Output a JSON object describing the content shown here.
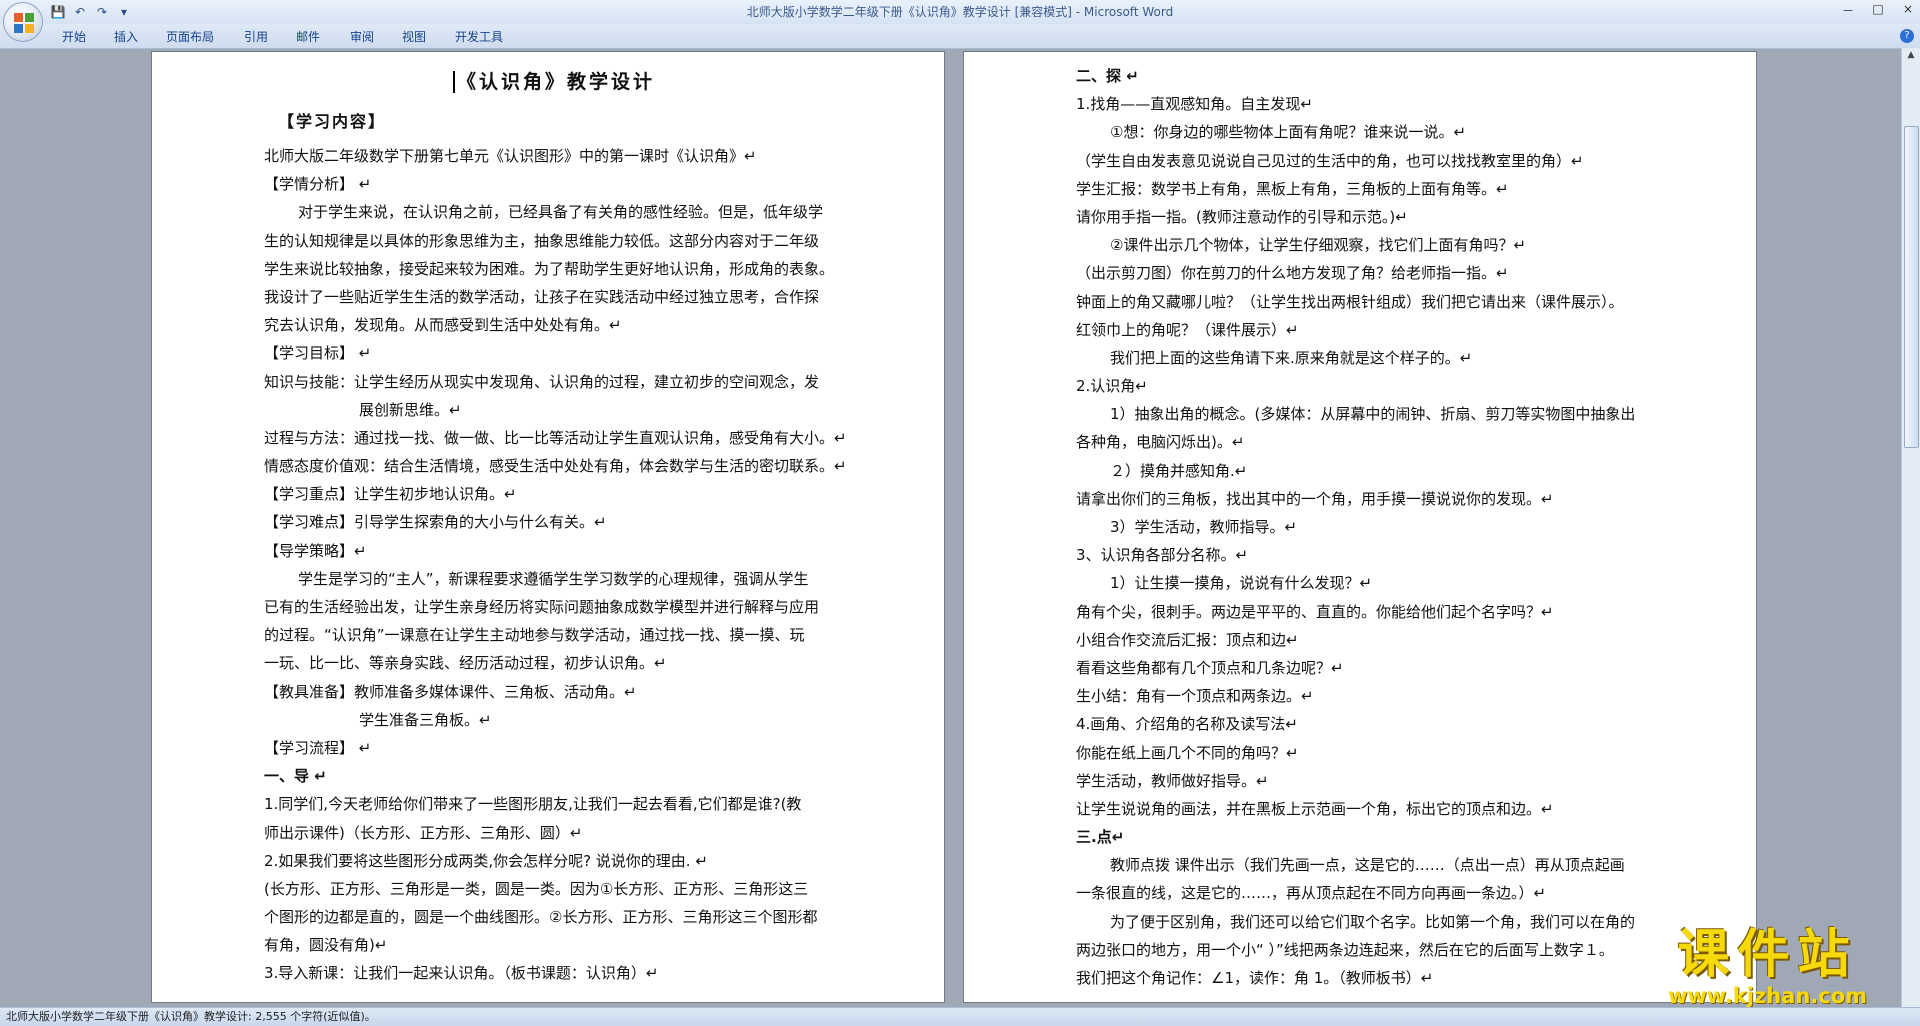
{
  "window": {
    "title": "北师大版小学数学二年级下册《认识角》教学设计 [兼容模式] - Microsoft Word",
    "controls": [
      "－",
      "□",
      "×"
    ]
  },
  "qat": [
    "💾",
    "↶",
    "↷",
    "▾"
  ],
  "tabs": [
    "开始",
    "插入",
    "页面布局",
    "引用",
    "邮件",
    "审阅",
    "视图",
    "开发工具"
  ],
  "left_page": {
    "title": "《认识角》教学设计",
    "subhead": "【学习内容】",
    "lines": [
      {
        "t": "北师大版二年级数学下册第七单元《认识图形》中的第一课时《认识角》↵",
        "c": ""
      },
      {
        "t": "【学情分析】 ↵",
        "c": ""
      },
      {
        "t": "对于学生来说，在认识角之前，已经具备了有关角的感性经验。但是，低年级学",
        "c": "ind1"
      },
      {
        "t": "生的认知规律是以具体的形象思维为主，抽象思维能力较低。这部分内容对于二年级",
        "c": ""
      },
      {
        "t": "学生来说比较抽象，接受起来较为困难。为了帮助学生更好地认识角，形成角的表象。",
        "c": ""
      },
      {
        "t": "我设计了一些贴近学生生活的数学活动，让孩子在实践活动中经过独立思考，合作探",
        "c": ""
      },
      {
        "t": "究去认识角，发现角。从而感受到生活中处处有角。↵",
        "c": ""
      },
      {
        "t": "【学习目标】 ↵",
        "c": ""
      },
      {
        "t": "知识与技能：让学生经历从现实中发现角、认识角的过程，建立初步的空间观念，发",
        "c": ""
      },
      {
        "t": "展创新思维。↵",
        "c": "ind3"
      },
      {
        "t": "过程与方法：通过找一找、做一做、比一比等活动让学生直观认识角，感受角有大小。↵",
        "c": ""
      },
      {
        "t": "情感态度价值观：结合生活情境，感受生活中处处有角，体会数学与生活的密切联系。↵",
        "c": ""
      },
      {
        "t": "【学习重点】让学生初步地认识角。↵",
        "c": ""
      },
      {
        "t": "【学习难点】引导学生探索角的大小与什么有关。↵",
        "c": ""
      },
      {
        "t": "【导学策略】↵",
        "c": ""
      },
      {
        "t": "学生是学习的“主人”，新课程要求遵循学生学习数学的心理规律，强调从学生",
        "c": "ind1"
      },
      {
        "t": "已有的生活经验出发，让学生亲身经历将实际问题抽象成数学模型并进行解释与应用",
        "c": ""
      },
      {
        "t": "的过程。“认识角”一课意在让学生主动地参与数学活动，通过找一找、摸一摸、玩",
        "c": ""
      },
      {
        "t": "一玩、比一比、等亲身实践、经历活动过程，初步认识角。↵",
        "c": ""
      },
      {
        "t": "【教具准备】教师准备多媒体课件、三角板、活动角。↵",
        "c": ""
      },
      {
        "t": "学生准备三角板。↵",
        "c": "ind3"
      },
      {
        "t": "【学习流程】 ↵",
        "c": ""
      },
      {
        "t": "一、导 ↵",
        "c": "bold"
      },
      {
        "t": "1.同学们,今天老师给你们带来了一些图形朋友,让我们一起去看看,它们都是谁?(教",
        "c": ""
      },
      {
        "t": "师出示课件)（长方形、正方形、三角形、圆）↵",
        "c": ""
      },
      {
        "t": "2.如果我们要将这些图形分成两类,你会怎样分呢? 说说你的理由. ↵",
        "c": ""
      },
      {
        "t": "(长方形、正方形、三角形是一类，圆是一类。因为①长方形、正方形、三角形这三",
        "c": ""
      },
      {
        "t": "个图形的边都是直的，圆是一个曲线图形。②长方形、正方形、三角形这三个图形都",
        "c": ""
      },
      {
        "t": "有角，圆没有角)↵",
        "c": ""
      },
      {
        "t": "3.导入新课：让我们一起来认识角。（板书课题：认识角）↵",
        "c": ""
      }
    ]
  },
  "right_page": {
    "lines": [
      {
        "t": "二、探 ↵",
        "c": "bold"
      },
      {
        "t": "1.找角——直观感知角。自主发现↵",
        "c": ""
      },
      {
        "t": "①想：你身边的哪些物体上面有角呢？谁来说一说。↵",
        "c": "ind1"
      },
      {
        "t": "（学生自由发表意见说说自己见过的生活中的角，也可以找找教室里的角）↵",
        "c": ""
      },
      {
        "t": "学生汇报：数学书上有角，黑板上有角，三角板的上面有角等。↵",
        "c": ""
      },
      {
        "t": "请你用手指一指。(教师注意动作的引导和示范。)↵",
        "c": ""
      },
      {
        "t": "②课件出示几个物体，让学生仔细观察，找它们上面有角吗？↵",
        "c": "ind1"
      },
      {
        "t": "（出示剪刀图）你在剪刀的什么地方发现了角？给老师指一指。↵",
        "c": ""
      },
      {
        "t": "钟面上的角又藏哪儿啦？（让学生找出两根针组成）我们把它请出来（课件展示）。",
        "c": ""
      },
      {
        "t": "红领巾上的角呢？（课件展示）↵",
        "c": ""
      },
      {
        "t": "我们把上面的这些角请下来.原来角就是这个样子的。↵",
        "c": "ind1"
      },
      {
        "t": "2.认识角↵",
        "c": ""
      },
      {
        "t": "1）抽象出角的概念。(多媒体：从屏幕中的闹钟、折扇、剪刀等实物图中抽象出",
        "c": "ind1"
      },
      {
        "t": "各种角，电脑闪烁出)。↵",
        "c": ""
      },
      {
        "t": "２）摸角并感知角.↵",
        "c": "ind1"
      },
      {
        "t": "请拿出你们的三角板，找出其中的一个角，用手摸一摸说说你的发现。↵",
        "c": ""
      },
      {
        "t": "3）学生活动，教师指导。↵",
        "c": "ind1"
      },
      {
        "t": "3、认识角各部分名称。↵",
        "c": ""
      },
      {
        "t": "1）让生摸一摸角，说说有什么发现？↵",
        "c": "ind1"
      },
      {
        "t": "角有个尖，很刺手。两边是平平的、直直的。你能给他们起个名字吗？↵",
        "c": ""
      },
      {
        "t": "小组合作交流后汇报：顶点和边↵",
        "c": ""
      },
      {
        "t": "看看这些角都有几个顶点和几条边呢？↵",
        "c": ""
      },
      {
        "t": "生小结：角有一个顶点和两条边。↵",
        "c": ""
      },
      {
        "t": "4.画角、介绍角的名称及读写法↵",
        "c": ""
      },
      {
        "t": "你能在纸上画几个不同的角吗？↵",
        "c": ""
      },
      {
        "t": "学生活动，教师做好指导。↵",
        "c": ""
      },
      {
        "t": "让学生说说角的画法，并在黑板上示范画一个角，标出它的顶点和边。↵",
        "c": ""
      },
      {
        "t": "三.点↵",
        "c": "bold"
      },
      {
        "t": "教师点拨 课件出示（我们先画一点，这是它的……（点出一点）再从顶点起画",
        "c": "ind1"
      },
      {
        "t": "一条很直的线，这是它的……，再从顶点起在不同方向再画一条边。）↵",
        "c": ""
      },
      {
        "t": "为了便于区别角，我们还可以给它们取个名字。比如第一个角，我们可以在角的",
        "c": "ind1"
      },
      {
        "t": "两边张口的地方，用一个小“ ）”线把两条边连起来，然后在它的后面写上数字１。",
        "c": ""
      },
      {
        "t": "我们把这个角记作：∠1，读作：角 1。（教师板书）↵",
        "c": ""
      }
    ]
  },
  "status": {
    "text": "北师大版小学数学二年级下册《认识角》教学设计: 2,555 个字符(近似值)。"
  },
  "watermark": {
    "big": "课件站",
    "small": "www.kjzhan.com"
  }
}
